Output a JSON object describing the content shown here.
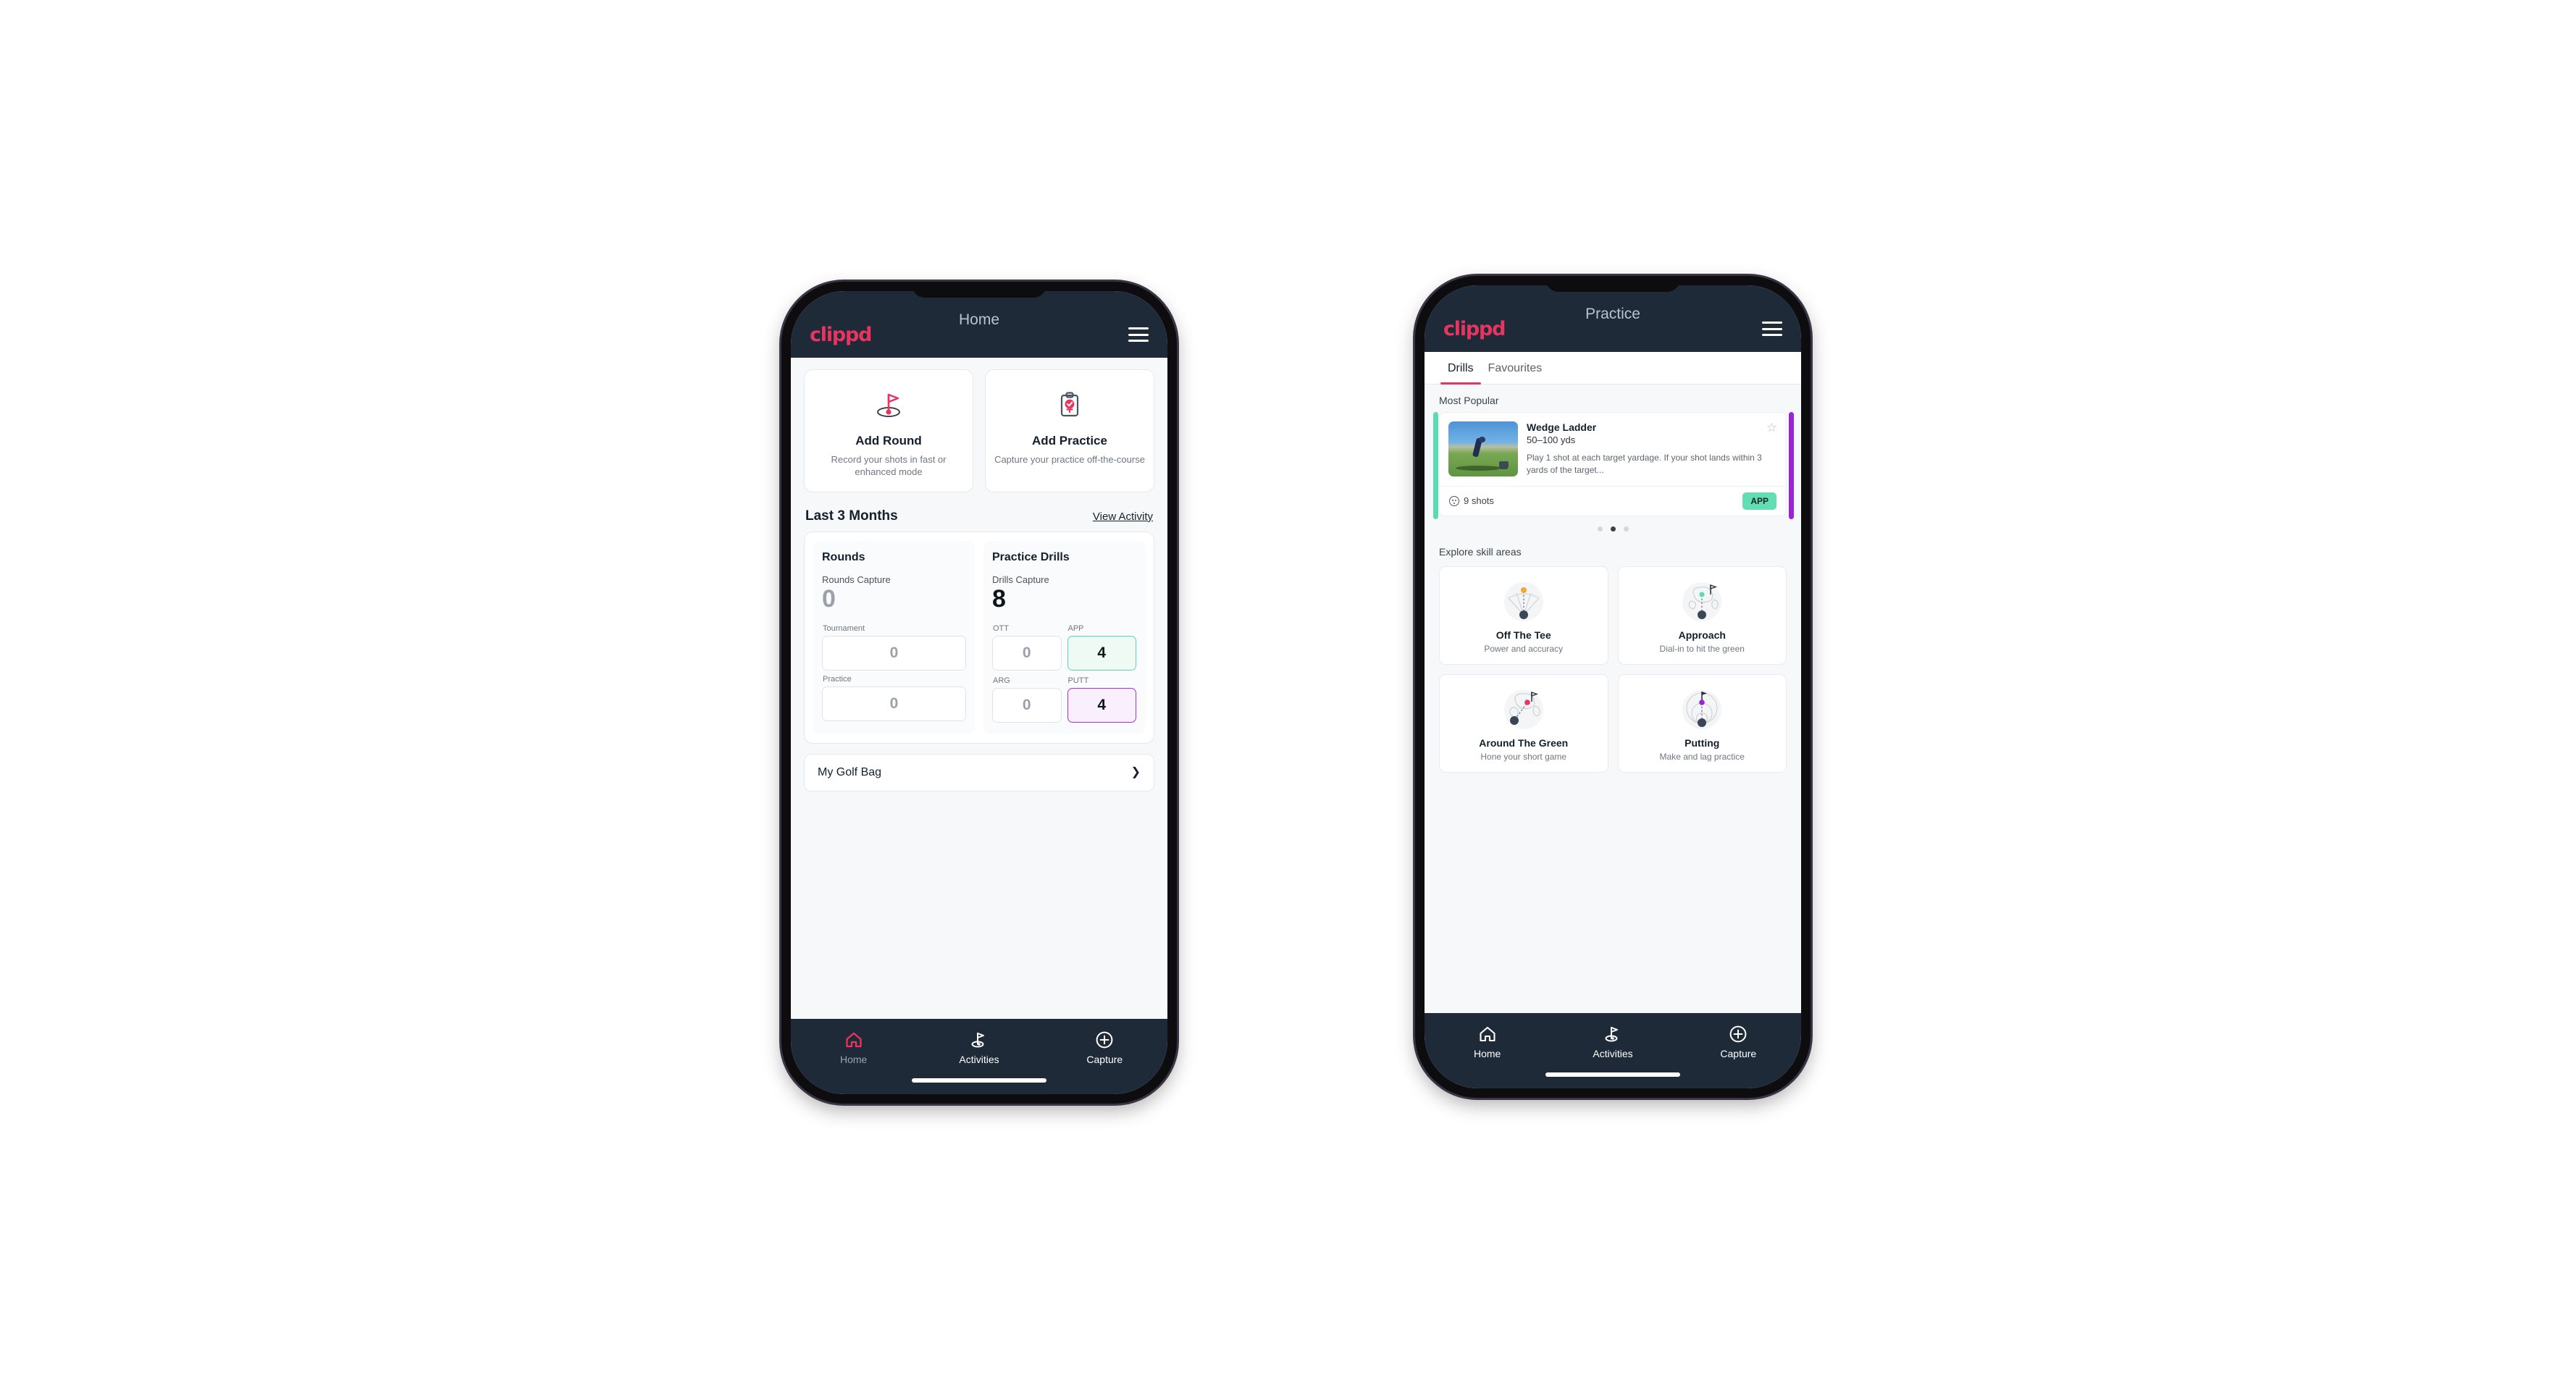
{
  "phones": {
    "home": {
      "header": {
        "logo": "clippd",
        "title": "Home",
        "menu_icon": "hamburger-menu-icon"
      },
      "actions": [
        {
          "icon": "golf-flag-hole-icon",
          "title": "Add Round",
          "subtitle": "Record your shots in fast or enhanced mode"
        },
        {
          "icon": "clipboard-check-icon",
          "title": "Add Practice",
          "subtitle": "Capture your practice off-the-course"
        }
      ],
      "section": {
        "title": "Last 3 Months",
        "link": "View Activity"
      },
      "stats": {
        "rounds": {
          "heading": "Rounds",
          "capture_label": "Rounds Capture",
          "capture_value": "0",
          "fields": [
            {
              "label": "Tournament",
              "value": "0",
              "state": "empty"
            },
            {
              "label": "Practice",
              "value": "0",
              "state": "empty"
            }
          ]
        },
        "drills": {
          "heading": "Practice Drills",
          "capture_label": "Drills Capture",
          "capture_value": "8",
          "fields": [
            {
              "label": "OTT",
              "value": "0",
              "state": "empty"
            },
            {
              "label": "APP",
              "value": "4",
              "state": "green"
            },
            {
              "label": "ARG",
              "value": "0",
              "state": "empty"
            },
            {
              "label": "PUTT",
              "value": "4",
              "state": "purple"
            }
          ]
        }
      },
      "golf_bag": {
        "label": "My Golf Bag",
        "icon": "chevron-right-icon"
      },
      "bottom_nav": [
        {
          "label": "Home",
          "icon": "home-icon",
          "active": true
        },
        {
          "label": "Activities",
          "icon": "golf-flag-icon",
          "active": false
        },
        {
          "label": "Capture",
          "icon": "plus-circle-icon",
          "active": false
        }
      ]
    },
    "practice": {
      "header": {
        "logo": "clippd",
        "title": "Practice",
        "menu_icon": "hamburger-menu-icon"
      },
      "tabs": [
        {
          "label": "Drills",
          "active": true
        },
        {
          "label": "Favourites",
          "active": false
        }
      ],
      "most_popular_label": "Most Popular",
      "drill": {
        "title": "Wedge Ladder",
        "yardage": "50–100 yds",
        "description": "Play 1 shot at each target yardage. If your shot lands within 3 yards of the target...",
        "shots": "9 shots",
        "tag": "APP",
        "star_icon": "star-outline-icon",
        "shots_icon": "golf-ball-icon",
        "thumbnail": "golfer-wedge-shot-photo"
      },
      "carousel_dots": {
        "count": 3,
        "active_index": 1
      },
      "explore_label": "Explore skill areas",
      "skills": [
        {
          "name": "Off The Tee",
          "sub": "Power and accuracy",
          "icon": "tee-shot-dispersion-icon",
          "accent": "#f0a92d"
        },
        {
          "name": "Approach",
          "sub": "Dial-in to hit the green",
          "icon": "approach-green-icon",
          "accent": "#5fd9b0"
        },
        {
          "name": "Around The Green",
          "sub": "Hone your short game",
          "icon": "chip-around-green-icon",
          "accent": "#e8355f"
        },
        {
          "name": "Putting",
          "sub": "Make and lag practice",
          "icon": "putting-rings-icon",
          "accent": "#9b22d6"
        }
      ],
      "bottom_nav": [
        {
          "label": "Home",
          "icon": "home-icon",
          "active": false
        },
        {
          "label": "Activities",
          "icon": "golf-flag-icon",
          "active": false
        },
        {
          "label": "Capture",
          "icon": "plus-circle-icon",
          "active": false
        }
      ]
    }
  },
  "colors": {
    "brand_pink": "#e8355f",
    "appbar_dark": "#1e2a38",
    "accent_green": "#5fd9b0",
    "accent_purple": "#9b22d6",
    "page_bg": "#f7f8fa"
  }
}
